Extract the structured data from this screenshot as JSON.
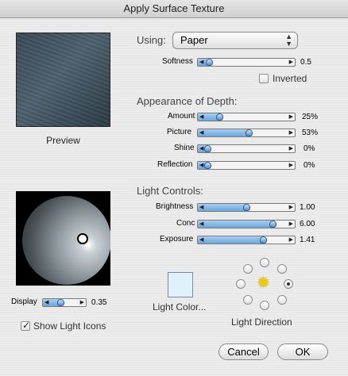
{
  "window": {
    "title": "Apply Surface Texture"
  },
  "preview": {
    "caption": "Preview"
  },
  "using": {
    "label": "Using:",
    "value": "Paper"
  },
  "softness": {
    "label": "Softness",
    "value": "0.5",
    "level": 0.05
  },
  "inverted": {
    "label": "Inverted",
    "checked": false
  },
  "depth": {
    "heading": "Appearance of Depth:",
    "rows": [
      {
        "label": "Amount",
        "value": "25%",
        "level": 0.17
      },
      {
        "label": "Picture",
        "value": "53%",
        "level": 0.53
      },
      {
        "label": "Shine",
        "value": "0%",
        "level": 0.03
      },
      {
        "label": "Reflection",
        "value": "0%",
        "level": 0.03
      }
    ]
  },
  "light": {
    "heading": "Light Controls:",
    "rows": [
      {
        "label": "Brightness",
        "value": "1.00",
        "level": 0.5
      },
      {
        "label": "Conc",
        "value": "6.00",
        "level": 0.82
      },
      {
        "label": "Exposure",
        "value": "1.41",
        "level": 0.7
      }
    ]
  },
  "display": {
    "label": "Display",
    "value": "0.35",
    "level": 0.35
  },
  "show_light_icons": {
    "label": "Show Light Icons",
    "checked": true
  },
  "light_color": {
    "label": "Light Color...",
    "color": "#e0f1fb"
  },
  "light_direction": {
    "label": "Light Direction",
    "selected": "east"
  },
  "buttons": {
    "cancel": "Cancel",
    "ok": "OK"
  },
  "colors": {
    "accent": "#6aa6dd",
    "sun": "#e9c81a"
  }
}
